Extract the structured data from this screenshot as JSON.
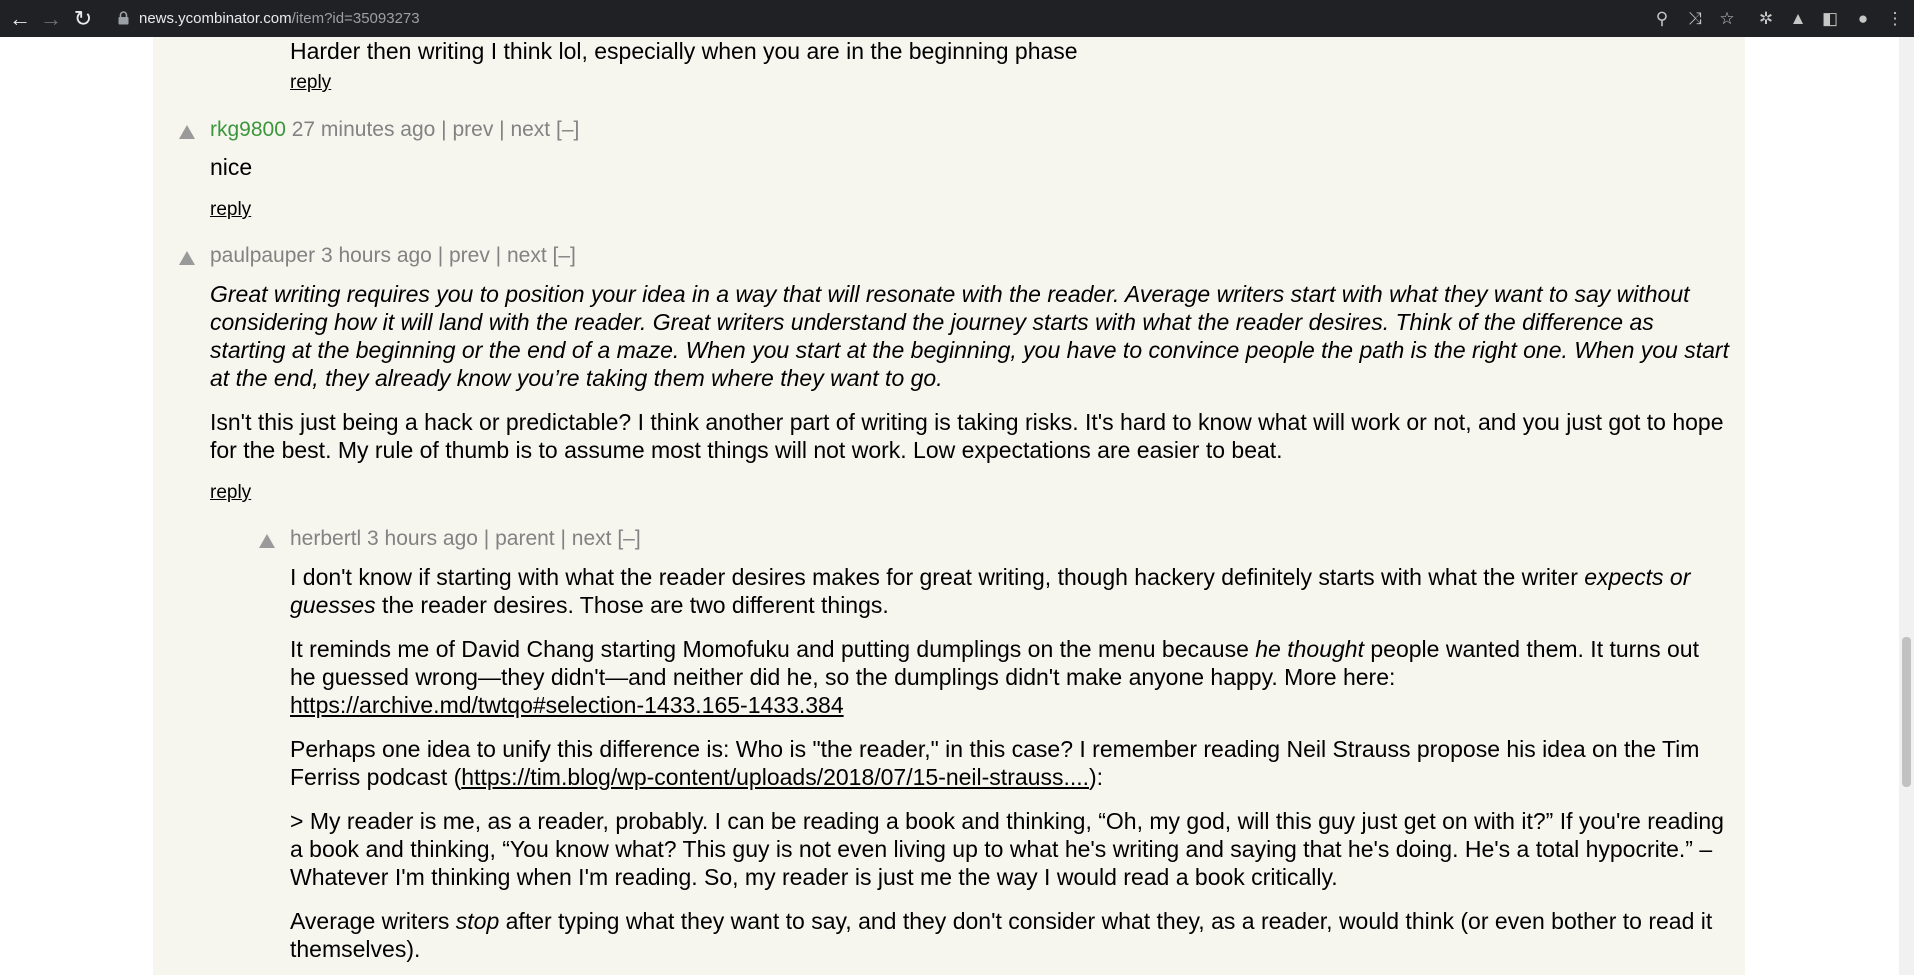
{
  "browser": {
    "url_host": "news.ycombinator.com",
    "url_path": "/item?id=35093273"
  },
  "comments": [
    {
      "text_tail": "Harder then writing I think lol, especially when you are in the beginning phase",
      "reply": "reply"
    },
    {
      "user": "rkg9800",
      "age": "27 minutes ago",
      "links": [
        "prev",
        "next",
        "[–]"
      ],
      "text": "nice",
      "reply": "reply"
    },
    {
      "user": "paulpauper",
      "age": "3 hours ago",
      "links": [
        "prev",
        "next",
        "[–]"
      ],
      "p1_italic": "Great writing requires you to position your idea in a way that will resonate with the reader. Average writers start with what they want to say without considering how it will land with the reader. Great writers understand the journey starts with what the reader desires. Think of the difference as starting at the beginning or the end of a maze. When you start at the beginning, you have to convince people the path is the right one. When you start at the end, they already know you’re taking them where they want to go.",
      "p2": "Isn't this just being a hack or predictable? I think another part of writing is taking risks. It's hard to know what will work or not, and you just got to hope for the best. My rule of thumb is to assume most things will not work. Low expectations are easier to beat.",
      "reply": "reply"
    },
    {
      "user": "herbertl",
      "age": "3 hours ago",
      "links": [
        "parent",
        "next",
        "[–]"
      ],
      "p1a": "I don't know if starting with what the reader desires makes for great writing, though hackery definitely starts with what the writer ",
      "p1_em": "expects or guesses",
      "p1b": " the reader desires. Those are two different things.",
      "p2a": "It reminds me of David Chang starting Momofuku and putting dumplings on the menu because ",
      "p2_em": "he thought",
      "p2b": " people wanted them. It turns out he guessed wrong—they didn't—and neither did he, so the dumplings didn't make anyone happy. More here: ",
      "p2_link": "https://archive.md/twtqo#selection-1433.165-1433.384",
      "p3a": "Perhaps one idea to unify this difference is: Who is \"the reader,\" in this case? I remember reading Neil Strauss propose his idea on the Tim Ferriss podcast (",
      "p3_link": "https://tim.blog/wp-content/uploads/2018/07/15-neil-strauss....",
      "p3b": "):",
      "p4": "> My reader is me, as a reader, probably. I can be reading a book and thinking, “Oh, my god, will this guy just get on with it?” If you're reading a book and thinking, “You know what? This guy is not even living up to what he's writing and saying that he's doing. He's a total hypocrite.” – Whatever I'm thinking when I'm reading. So, my reader is just me the way I would read a book critically.",
      "p5a": "Average writers ",
      "p5_em": "stop",
      "p5b": " after typing what they want to say, and they don't consider what they, as a reader, would think (or even bother to read it themselves)."
    }
  ],
  "colors": {
    "background": "#f6f6ef",
    "meta": "#828282",
    "new_user": "#3c963c",
    "chrome": "#202124"
  }
}
